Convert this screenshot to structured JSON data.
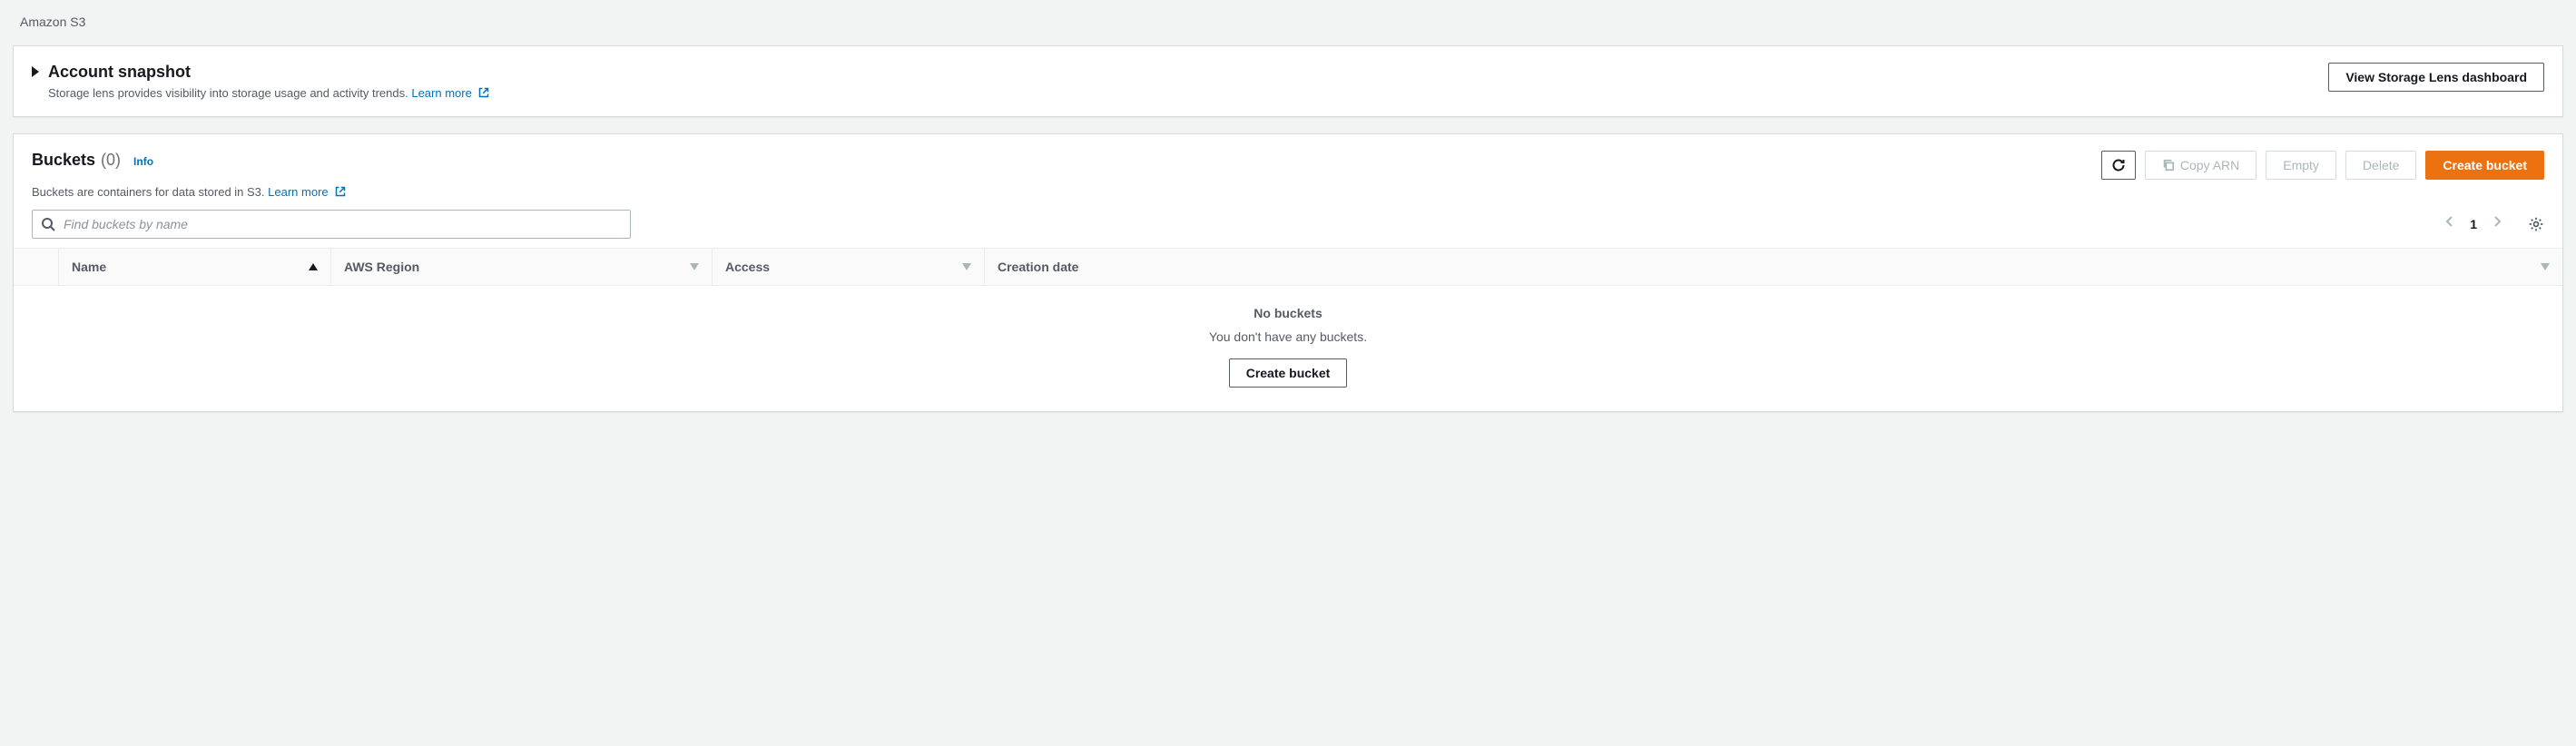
{
  "breadcrumb": "Amazon S3",
  "snapshot": {
    "title": "Account snapshot",
    "desc": "Storage lens provides visibility into storage usage and activity trends.",
    "learn_more": "Learn more",
    "button": "View Storage Lens dashboard"
  },
  "buckets": {
    "title": "Buckets",
    "count": "(0)",
    "info": "Info",
    "desc": "Buckets are containers for data stored in S3.",
    "learn_more": "Learn more",
    "search_placeholder": "Find buckets by name",
    "actions": {
      "copy_arn": "Copy ARN",
      "empty": "Empty",
      "delete": "Delete",
      "create": "Create bucket"
    },
    "pagination": {
      "current": "1"
    },
    "columns": {
      "name": "Name",
      "region": "AWS Region",
      "access": "Access",
      "date": "Creation date"
    },
    "empty_state": {
      "title": "No buckets",
      "sub": "You don't have any buckets.",
      "button": "Create bucket"
    }
  }
}
